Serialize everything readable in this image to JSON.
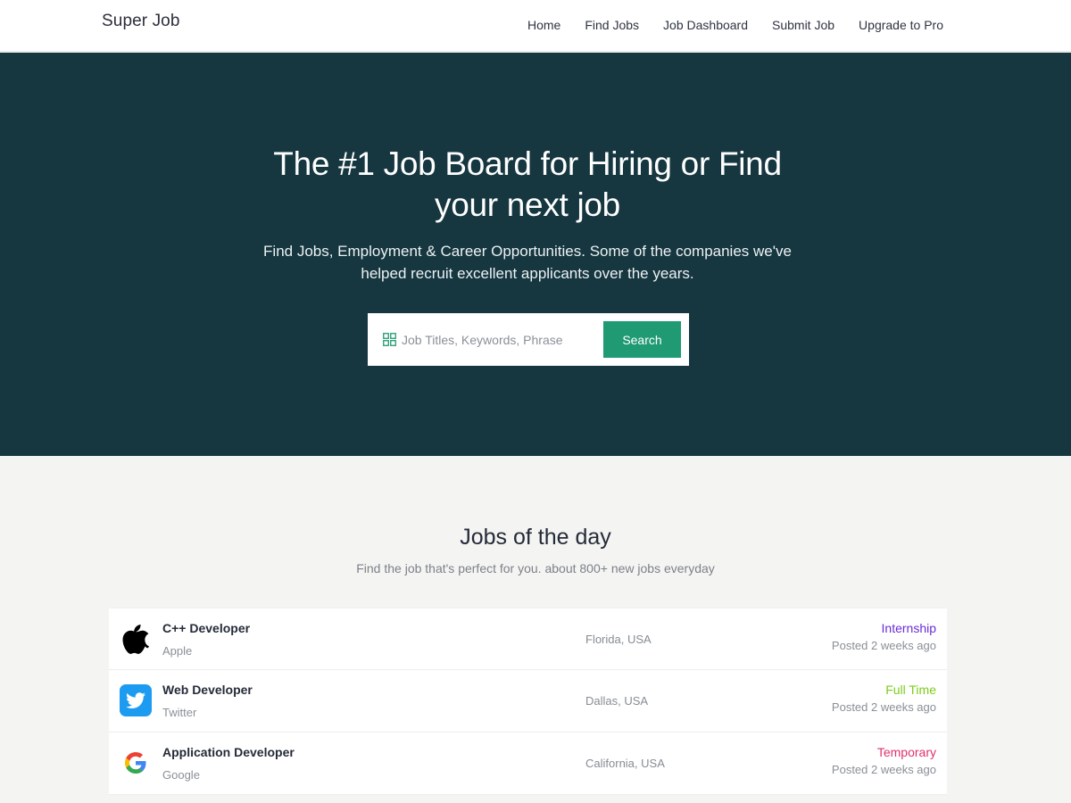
{
  "header": {
    "brand": "Super Job",
    "nav": [
      "Home",
      "Find Jobs",
      "Job Dashboard",
      "Submit Job",
      "Upgrade to Pro"
    ]
  },
  "hero": {
    "title": "The #1 Job Board for Hiring or Find your next job",
    "subtitle": "Find Jobs, Employment & Career Opportunities. Some of the companies we've helped recruit excellent applicants over the years.",
    "search": {
      "placeholder": "Job Titles, Keywords, Phrase",
      "button_label": "Search"
    }
  },
  "jobs_section": {
    "title": "Jobs of the day",
    "subtitle": "Find the job that's perfect for you. about 800+ new jobs everyday",
    "jobs": [
      {
        "title": "C++ Developer",
        "company": "Apple",
        "location": "Florida, USA",
        "type": "Internship",
        "type_color": "#6a2bd6",
        "posted": "Posted 2 weeks ago",
        "logo": "apple-icon"
      },
      {
        "title": "Web Developer",
        "company": "Twitter",
        "location": "Dallas, USA",
        "type": "Full Time",
        "type_color": "#7ccd19",
        "posted": "Posted 2 weeks ago",
        "logo": "twitter-icon"
      },
      {
        "title": "Application Developer",
        "company": "Google",
        "location": "California, USA",
        "type": "Temporary",
        "type_color": "#e2306c",
        "posted": "Posted 2 weeks ago",
        "logo": "google-icon"
      }
    ]
  },
  "colors": {
    "hero_bg": "#163640",
    "accent": "#1f9a72"
  }
}
